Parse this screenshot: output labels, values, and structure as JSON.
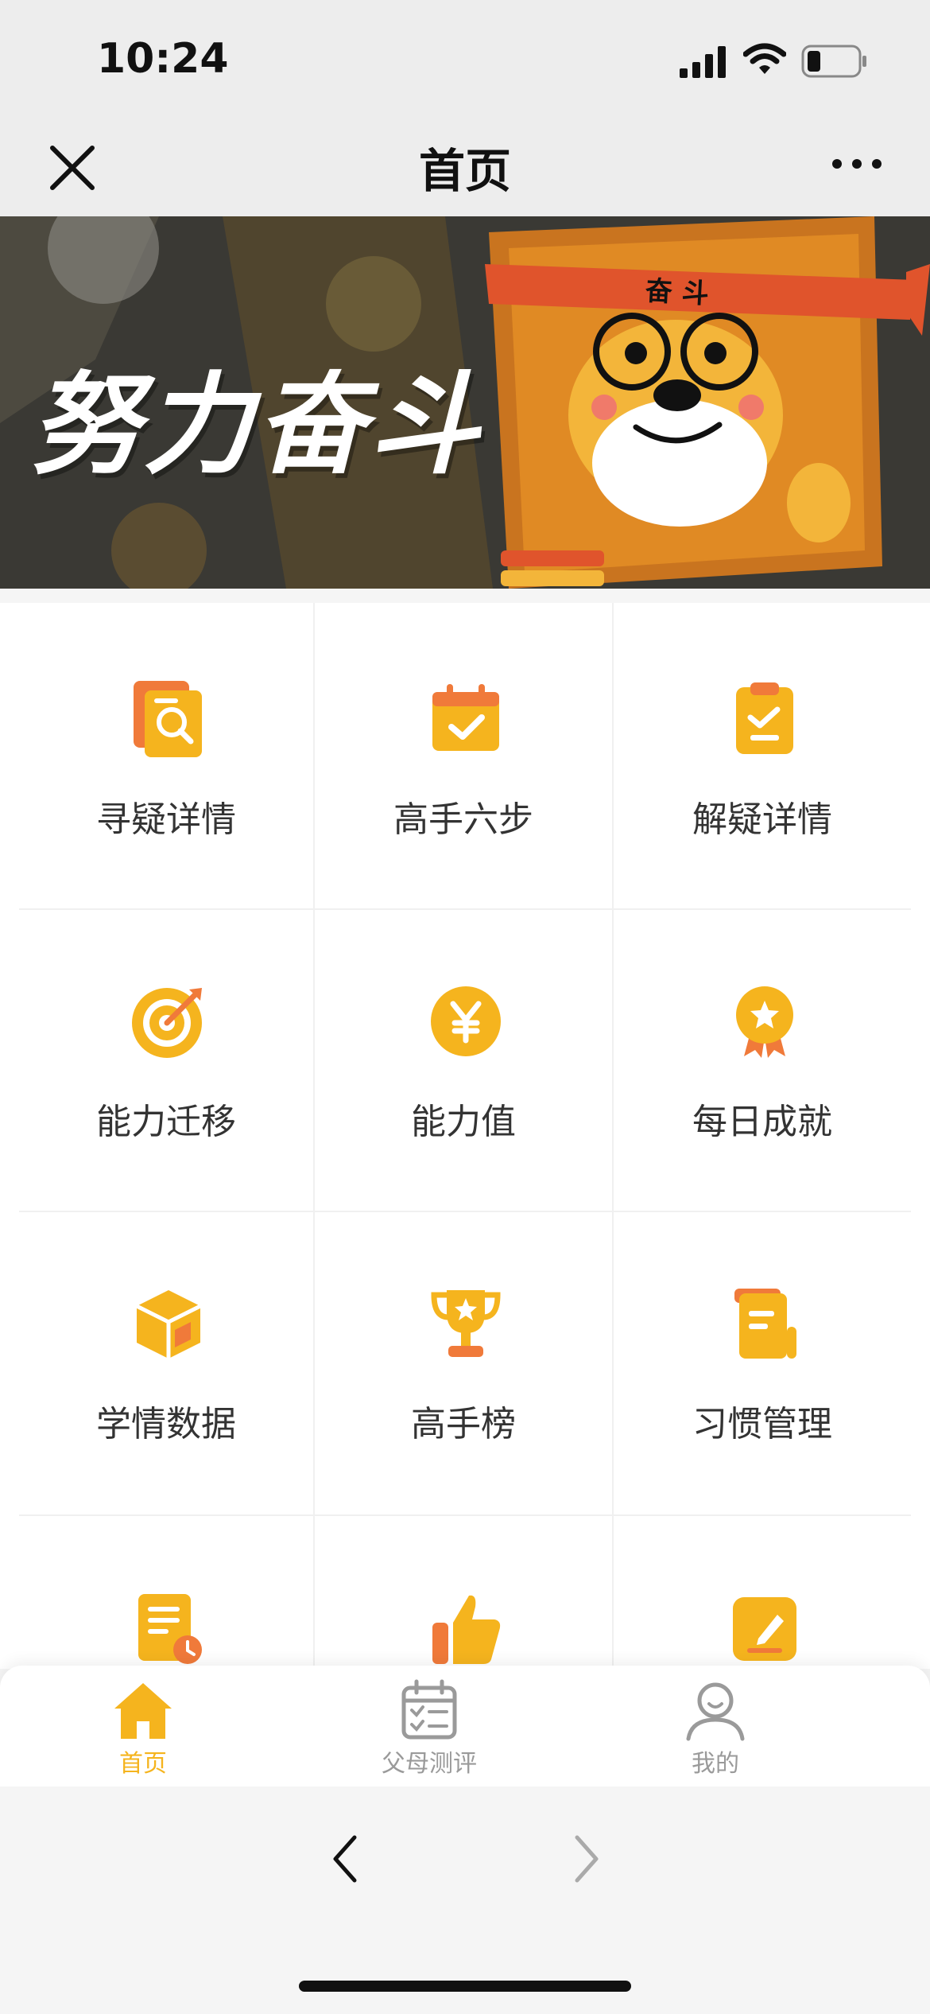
{
  "status_bar": {
    "time": "10:24"
  },
  "nav": {
    "title": "首页"
  },
  "banner": {
    "text": "努力奋斗",
    "headband_text": "奋 斗"
  },
  "grid": [
    {
      "label": "寻疑详情",
      "icon": "search-document-icon"
    },
    {
      "label": "高手六步",
      "icon": "calendar-check-icon"
    },
    {
      "label": "解疑详情",
      "icon": "clipboard-check-icon"
    },
    {
      "label": "能力迁移",
      "icon": "target-icon"
    },
    {
      "label": "能力值",
      "icon": "yen-coin-icon"
    },
    {
      "label": "每日成就",
      "icon": "medal-icon"
    },
    {
      "label": "学情数据",
      "icon": "cube-icon"
    },
    {
      "label": "高手榜",
      "icon": "trophy-icon"
    },
    {
      "label": "习惯管理",
      "icon": "scroll-icon"
    },
    {
      "label": "",
      "icon": "document-clock-icon"
    },
    {
      "label": "",
      "icon": "thumbs-up-icon"
    },
    {
      "label": "",
      "icon": "edit-note-icon"
    }
  ],
  "tabbar": {
    "items": [
      {
        "label": "首页",
        "icon": "home-icon",
        "active": true
      },
      {
        "label": "父母测评",
        "icon": "calendar-list-icon",
        "active": false
      },
      {
        "label": "我的",
        "icon": "user-icon",
        "active": false
      }
    ],
    "active_color": "#f5b41e",
    "inactive_color": "#9a9a9a"
  },
  "colors": {
    "accent": "#f5b41e",
    "orange": "#f07a3a",
    "banner_red": "#e0542c"
  }
}
